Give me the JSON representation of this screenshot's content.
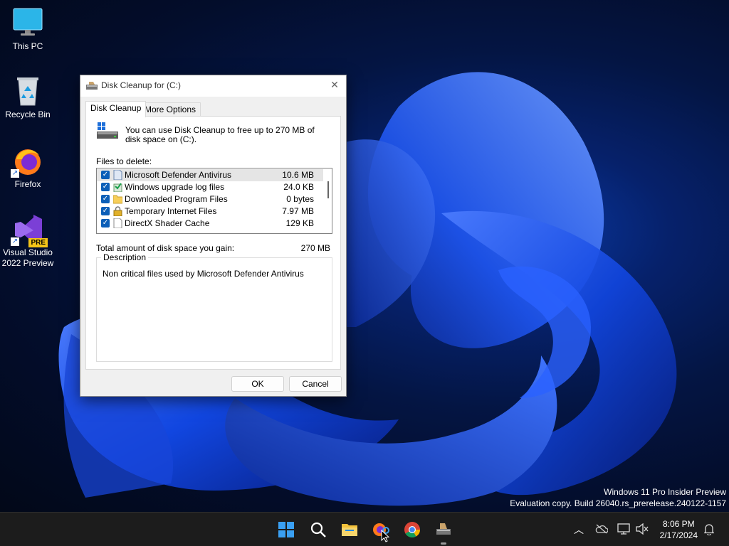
{
  "desktop": {
    "icons": [
      {
        "label": "This PC",
        "icon": "monitor-icon"
      },
      {
        "label": "Recycle Bin",
        "icon": "recycle-bin-icon"
      },
      {
        "label": "Firefox",
        "icon": "firefox-icon"
      },
      {
        "label_line1": "Visual Studio",
        "label_line2": "2022 Preview",
        "badge": "PRE",
        "icon": "visual-studio-icon"
      }
    ],
    "watermark": {
      "line1": "Windows 11 Pro Insider Preview",
      "line2": "Evaluation copy. Build 26040.rs_prerelease.240122-1157"
    }
  },
  "dialog": {
    "title": "Disk Cleanup for  (C:)",
    "close": "✕",
    "tabs": [
      {
        "label": "Disk Cleanup",
        "active": true
      },
      {
        "label": "More Options",
        "active": false
      }
    ],
    "info": "You can use Disk Cleanup to free up to 270 MB of disk space on  (C:).",
    "files_label": "Files to delete:",
    "files": [
      {
        "name": "Microsoft Defender Antivirus",
        "size": "10.6 MB",
        "checked": true,
        "icon": "document-icon"
      },
      {
        "name": "Windows upgrade log files",
        "size": "24.0 KB",
        "checked": true,
        "icon": "log-files-icon"
      },
      {
        "name": "Downloaded Program Files",
        "size": "0 bytes",
        "checked": true,
        "icon": "folder-icon"
      },
      {
        "name": "Temporary Internet Files",
        "size": "7.97 MB",
        "checked": true,
        "icon": "lock-icon"
      },
      {
        "name": "DirectX Shader Cache",
        "size": "129 KB",
        "checked": true,
        "icon": "blank-file-icon"
      }
    ],
    "total_label": "Total amount of disk space you gain:",
    "total_value": "270 MB",
    "description_label": "Description",
    "description_text": "Non critical files used by Microsoft Defender Antivirus",
    "ok_label": "OK",
    "cancel_label": "Cancel"
  },
  "taskbar": {
    "apps": [
      "start-icon",
      "search-icon",
      "file-explorer-icon",
      "firefox-icon",
      "chrome-icon",
      "disk-cleanup-icon"
    ],
    "time": "8:06 PM",
    "date": "2/17/2024"
  },
  "colors": {
    "accent": "#0c5fb8",
    "taskbar": "#1c1c1c",
    "wallpaper": "#06216b"
  }
}
